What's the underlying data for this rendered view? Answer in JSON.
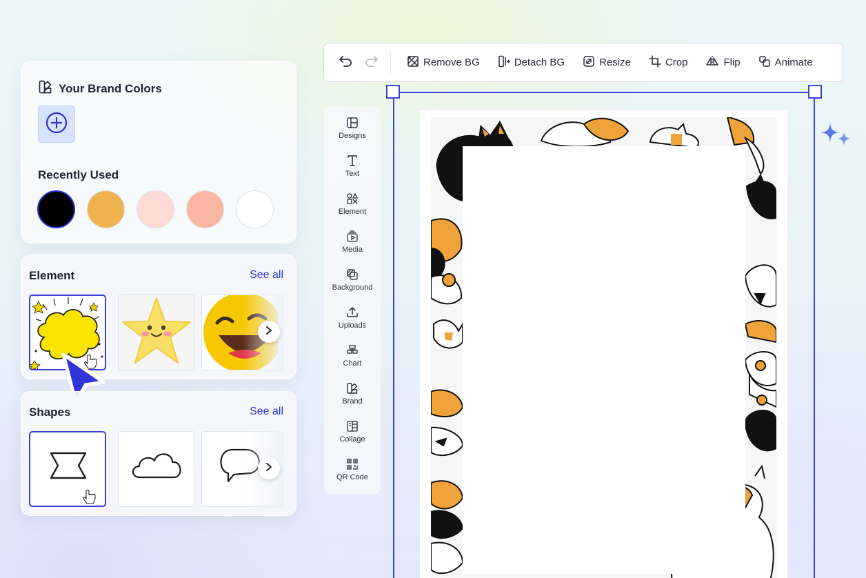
{
  "brand": {
    "title": "Your Brand Colors",
    "recent_label": "Recently Used",
    "swatches": [
      "#000000",
      "#f0b24e",
      "#fddad3",
      "#fdb5a4",
      "#ffffff"
    ]
  },
  "element": {
    "title": "Element",
    "see_all": "See all",
    "items": [
      "comic-burst-sticker",
      "smiling-star-sticker",
      "laughing-emoji-sticker"
    ]
  },
  "shapes": {
    "title": "Shapes",
    "see_all": "See all",
    "items": [
      "hourglass-shape",
      "cloud-shape",
      "speech-bubble-shape"
    ]
  },
  "toolbar": {
    "remove_bg": "Remove BG",
    "detach_bg": "Detach BG",
    "resize": "Resize",
    "crop": "Crop",
    "flip": "Flip",
    "animate": "Animate"
  },
  "rail": {
    "designs": "Designs",
    "text": "Text",
    "element": "Element",
    "media": "Media",
    "background": "Background",
    "uploads": "Uploads",
    "chart": "Chart",
    "brand": "Brand",
    "collage": "Collage",
    "qr_code": "QR Code"
  },
  "colors": {
    "accent": "#2c31d2",
    "cat_orange": "#f0a33a"
  }
}
